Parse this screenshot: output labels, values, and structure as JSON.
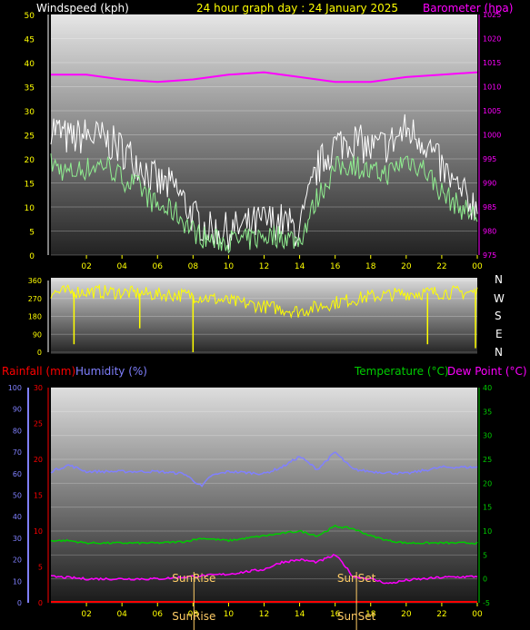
{
  "colors": {
    "background": "#000000",
    "windspeed_title": "#ffffff",
    "date_title": "#ffff00",
    "barometer": "#ff00ff",
    "axis_ticks": "#ffff00",
    "wind_gust": "#ffffff",
    "wind_avg": "#90ee90",
    "wind_dir": "#ffff00",
    "rainfall": "#ff0000",
    "humidity": "#8080ff",
    "temperature": "#00cc00",
    "dewpoint": "#ff00ff",
    "sun": "#ffcc66"
  },
  "top": {
    "left_title": "Windspeed (kph)",
    "center_title": "24 hour graph day : 24 January 2025",
    "right_title": "Barometer (hpa)"
  },
  "compass": [
    "N",
    "W",
    "S",
    "E",
    "N"
  ],
  "bottom": {
    "rainfall_title": "Rainfall (mm)",
    "humidity_title": "Humidity (%)",
    "temperature_title": "Temperature (°C)",
    "dewpoint_title": "Dew Point (°C)",
    "sunrise_label": "SunRise",
    "sunset_label": "SunSet"
  },
  "chart_data": [
    {
      "type": "line",
      "x_ticks": [
        "02",
        "04",
        "06",
        "08",
        "10",
        "12",
        "14",
        "16",
        "18",
        "20",
        "22",
        "00"
      ],
      "y_left_ticks": [
        0,
        5,
        10,
        15,
        20,
        25,
        30,
        35,
        40,
        45,
        50
      ],
      "y_right_ticks": [
        975,
        980,
        985,
        990,
        995,
        1000,
        1005,
        1010,
        1015,
        1020,
        1025
      ],
      "ylim_left": [
        0,
        50
      ],
      "ylim_right": [
        975,
        1025
      ],
      "series": [
        {
          "key": "gust",
          "axis": "left",
          "x_hours": [
            0,
            1,
            2,
            3,
            4,
            5,
            6,
            7,
            8,
            9,
            10,
            11,
            12,
            13,
            14,
            15,
            16,
            17,
            18,
            19,
            20,
            21,
            22,
            23,
            24
          ],
          "values": [
            27,
            24,
            25,
            24,
            22,
            19,
            15,
            14,
            8,
            5,
            5,
            6,
            7,
            7,
            5,
            18,
            23,
            24,
            22,
            23,
            26,
            24,
            18,
            13,
            10
          ]
        },
        {
          "key": "average",
          "axis": "left",
          "x_hours": [
            0,
            1,
            2,
            3,
            4,
            5,
            6,
            7,
            8,
            9,
            10,
            11,
            12,
            13,
            14,
            15,
            16,
            17,
            18,
            19,
            20,
            21,
            22,
            23,
            24
          ],
          "values": [
            19,
            17,
            18,
            19,
            16,
            14,
            10,
            9,
            5,
            3,
            3,
            3,
            4,
            4,
            3,
            12,
            18,
            19,
            17,
            17,
            20,
            18,
            13,
            10,
            8
          ]
        },
        {
          "key": "barometer",
          "axis": "right",
          "x_hours": [
            0,
            2,
            4,
            6,
            8,
            10,
            12,
            14,
            16,
            18,
            20,
            22,
            24
          ],
          "values": [
            1012.5,
            1012.5,
            1011.5,
            1011,
            1011.5,
            1012.5,
            1013,
            1012,
            1011,
            1011,
            1012,
            1012.5,
            1013
          ]
        }
      ]
    },
    {
      "type": "line",
      "x_ticks": [
        "02",
        "04",
        "06",
        "08",
        "10",
        "12",
        "14",
        "16",
        "18",
        "20",
        "22",
        "00"
      ],
      "y_ticks": [
        0,
        90,
        180,
        270,
        360
      ],
      "ylim": [
        0,
        360
      ],
      "series": [
        {
          "key": "wind_direction",
          "x_hours": [
            0,
            2,
            4,
            6,
            8,
            10,
            12,
            14,
            16,
            18,
            20,
            22,
            24
          ],
          "values": [
            300,
            305,
            300,
            290,
            285,
            255,
            230,
            205,
            250,
            280,
            295,
            300,
            300
          ]
        }
      ],
      "spikes": [
        {
          "x_hour": 1.3,
          "value": 40
        },
        {
          "x_hour": 5,
          "value": 120
        },
        {
          "x_hour": 8,
          "value": 0
        },
        {
          "x_hour": 21.2,
          "value": 40
        },
        {
          "x_hour": 23.9,
          "value": 20
        }
      ]
    },
    {
      "type": "line",
      "x_ticks": [
        "02",
        "04",
        "06",
        "08",
        "10",
        "12",
        "14",
        "16",
        "18",
        "20",
        "22",
        "00"
      ],
      "y_humidity_ticks": [
        0,
        10,
        20,
        30,
        40,
        50,
        60,
        70,
        80,
        90,
        100
      ],
      "y_rain_ticks": [
        0,
        5,
        10,
        15,
        20,
        25,
        30
      ],
      "y_temp_ticks": [
        -5,
        0,
        5,
        10,
        15,
        20,
        25,
        30,
        35,
        40
      ],
      "ylim_humidity": [
        0,
        100
      ],
      "ylim_rain": [
        0,
        30
      ],
      "ylim_temp": [
        -5,
        40
      ],
      "series": [
        {
          "key": "rainfall",
          "axis": "rain",
          "x_hours": [
            0,
            24
          ],
          "values": [
            0,
            0
          ]
        },
        {
          "key": "humidity",
          "axis": "humidity",
          "x_hours": [
            0,
            1,
            2,
            4,
            6,
            7.5,
            8.5,
            9,
            10,
            12,
            13,
            14,
            15,
            16,
            16.5,
            17,
            18,
            20,
            22,
            24
          ],
          "values": [
            61,
            64,
            61,
            61,
            61,
            60,
            54,
            59,
            61,
            60,
            63,
            68,
            62,
            70,
            66,
            62,
            61,
            60,
            63,
            63
          ]
        },
        {
          "key": "temperature",
          "axis": "temp",
          "x_hours": [
            0,
            1,
            2,
            4,
            6,
            7.5,
            8.5,
            10,
            12,
            13,
            14,
            15,
            16,
            17,
            18,
            19,
            20,
            22,
            24
          ],
          "values": [
            8,
            8,
            7.5,
            7.5,
            7.5,
            7.8,
            8.5,
            8,
            9,
            9.5,
            10,
            9,
            11,
            10.5,
            9,
            8,
            7.5,
            7.5,
            7.5
          ]
        },
        {
          "key": "dewpoint",
          "axis": "temp",
          "x_hours": [
            0,
            2,
            4,
            6,
            8,
            10,
            12,
            13,
            14,
            15,
            16,
            16.5,
            17,
            18,
            19,
            20,
            22,
            24
          ],
          "values": [
            0.5,
            0,
            0,
            0,
            0.5,
            1,
            2,
            3.5,
            4,
            3.5,
            5,
            3,
            0.5,
            0,
            -1,
            -0.3,
            0.3,
            0.5
          ]
        }
      ],
      "sunrise_hour": 8.05,
      "sunset_hour": 17.2
    }
  ]
}
